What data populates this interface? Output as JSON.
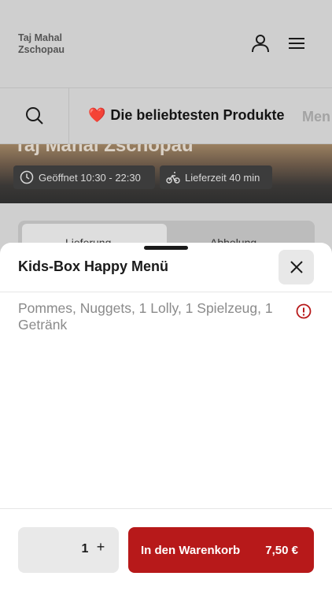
{
  "header": {
    "brand_line1": "Taj Mahal",
    "brand_line2": "Zschopau",
    "icons": [
      "user-icon",
      "menu-icon"
    ]
  },
  "category_bar": {
    "search_icon": "search-icon",
    "active_category": "Die beliebtesten Produkte",
    "active_emoji": "❤️",
    "next_category": "Men"
  },
  "hero": {
    "restaurant_name": "Taj Mahal Zschopau",
    "opening_hours": "Geöffnet 10:30 - 22:30",
    "delivery_time": "Lieferzeit 40 min"
  },
  "order_type_toggle": {
    "options": [
      "Lieferung",
      "Abholung"
    ],
    "selected": "Lieferung"
  },
  "product_sheet": {
    "title": "Kids-Box Happy Menü",
    "description": "Pommes, Nuggets, 1 Lolly, 1 Spielzeug, 1 Getränk",
    "quantity": "1",
    "plus_symbol": "+",
    "add_to_cart_label": "In den Warenkorb",
    "price": "7,50 €"
  },
  "colors": {
    "accent": "#b7191a",
    "overlay_background": "#cfcfcf",
    "sheet_background": "#ffffff",
    "quantity_background": "#e9e9e9"
  }
}
